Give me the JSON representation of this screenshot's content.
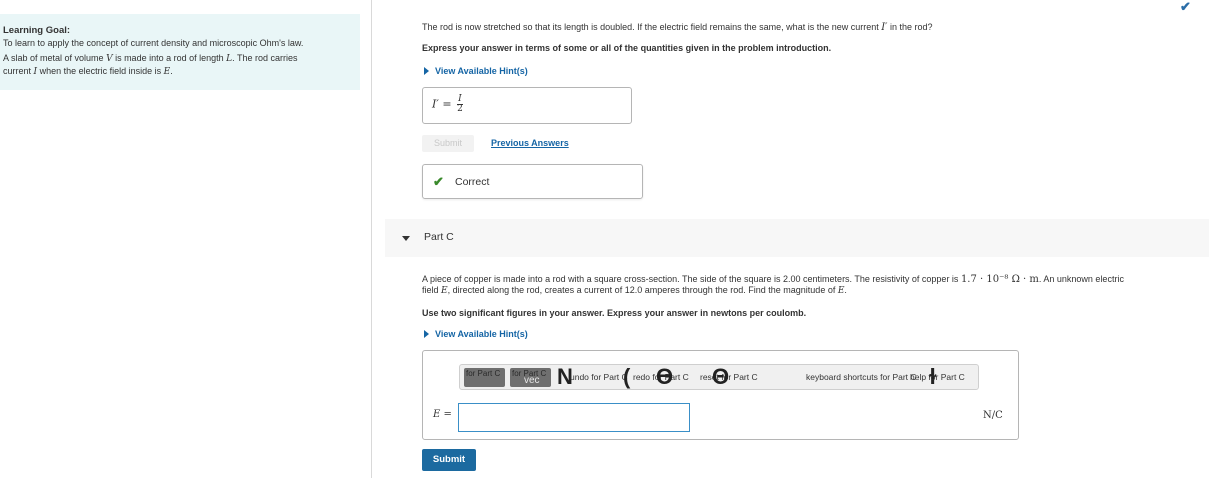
{
  "learning_goal": {
    "title": "Learning Goal:",
    "line1": "To learn to apply the concept of current density and microscopic Ohm's law.",
    "p2_a": "A slab of metal of volume ",
    "p2_V": "V",
    "p2_b": " is made into a rod of length ",
    "p2_L": "L",
    "p2_c": ". The rod carries",
    "p3_a": "current ",
    "p3_I": "I",
    "p3_b": " when the electric field inside is ",
    "p3_E": "E",
    "p3_c": "."
  },
  "part_b": {
    "question_a": "The rod is now stretched so that its length is doubled. If the electric field remains the same, what is the new current ",
    "question_sym": "I′",
    "question_b": " in the rod?",
    "instruction": "Express your answer in terms of some or all of the quantities given in the problem introduction.",
    "hint_link": "View Available Hint(s)",
    "answer_lhs": "I′ =",
    "answer_num": "I",
    "answer_den": "2",
    "submit_label": "Submit",
    "previous_answers": "Previous Answers",
    "feedback": "Correct",
    "top_check": "✔"
  },
  "part_c": {
    "label": "Part C",
    "problem_l1_a": "A piece of copper is made into a rod with a square cross-section. The side of the square is 2.00 centimeters. The resistivity of copper is ",
    "problem_l1_math": "1.7 · 10⁻⁸ Ω · m",
    "problem_l1_b": ". An unknown electric",
    "problem_l2_a": "field ",
    "problem_l2_E": "E",
    "problem_l2_b": ", directed along the rod, creates a current of 12.0 amperes through the rod. Find the magnitude of ",
    "problem_l2_E2": "E",
    "problem_l2_c": ".",
    "instruction": "Use two significant figures in your answer. Express your answer in newtons per coulomb.",
    "hint_link": "View Available Hint(s)",
    "toolbar": {
      "btn1": "for Part C",
      "btn2": "for Part C",
      "btn2_sub": "vec",
      "undo": "undo for Part C",
      "redo": "redo for Part C",
      "reset": "reset for Part C",
      "shortcuts": "keyboard shortcuts for Part C",
      "help": "help for Part C"
    },
    "field_label": "E =",
    "input_value": "",
    "unit": "N/C",
    "submit_label": "Submit"
  },
  "colors": {
    "goal_bg": "#e9f6f7",
    "link": "#1565a5",
    "submit_bg": "#1c6aa0",
    "correct": "#3a8a2c"
  }
}
